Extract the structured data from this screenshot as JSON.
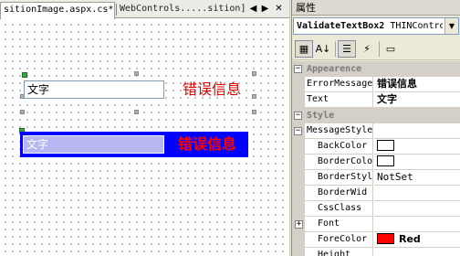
{
  "designer": {
    "tabs": [
      {
        "label": "sitionImage.aspx.cs*"
      },
      {
        "label": "WebControls.....sition]"
      }
    ],
    "tab_controls": {
      "prev": "◀",
      "next": "▶",
      "close": "✕"
    },
    "controls": [
      {
        "textbox_text": "文字",
        "error_message": "错误信息"
      },
      {
        "textbox_text": "文字",
        "error_message": "错误信息"
      }
    ]
  },
  "properties": {
    "title": "属性",
    "object_selector": {
      "name": "ValidateTextBox2",
      "type": " THINControls"
    },
    "dropdown_arrow": "▼",
    "toolbar": {
      "categorized": "▦",
      "alphabetical": "A↓",
      "properties": "☰",
      "events": "⚡",
      "pages": "▭"
    },
    "categories": [
      {
        "name": "Appearence",
        "expander": "−"
      },
      {
        "name": "Style",
        "expander": "−"
      }
    ],
    "rows": {
      "error_message": {
        "name": "ErrorMessage",
        "value": "错误信息"
      },
      "text": {
        "name": "Text",
        "value": "文字"
      },
      "message_style": {
        "name": "MessageStyle",
        "expander": "−"
      },
      "back_color": {
        "name": "BackColor",
        "swatch": "#ffffff"
      },
      "border_color": {
        "name": "BorderColo",
        "swatch": "#ffffff"
      },
      "border_style": {
        "name": "BorderStyl",
        "value": "NotSet"
      },
      "border_width": {
        "name": "BorderWid"
      },
      "css_class": {
        "name": "CssClass"
      },
      "font": {
        "name": "Font",
        "expander": "+"
      },
      "fore_color": {
        "name": "ForeColor",
        "value": "Red",
        "swatch": "#ff0000"
      },
      "height": {
        "name": "Height"
      }
    }
  },
  "colors": {
    "error_text": "#e00000",
    "control_bg": "#0000ff",
    "selected_textbox": "#b6b6f0"
  }
}
